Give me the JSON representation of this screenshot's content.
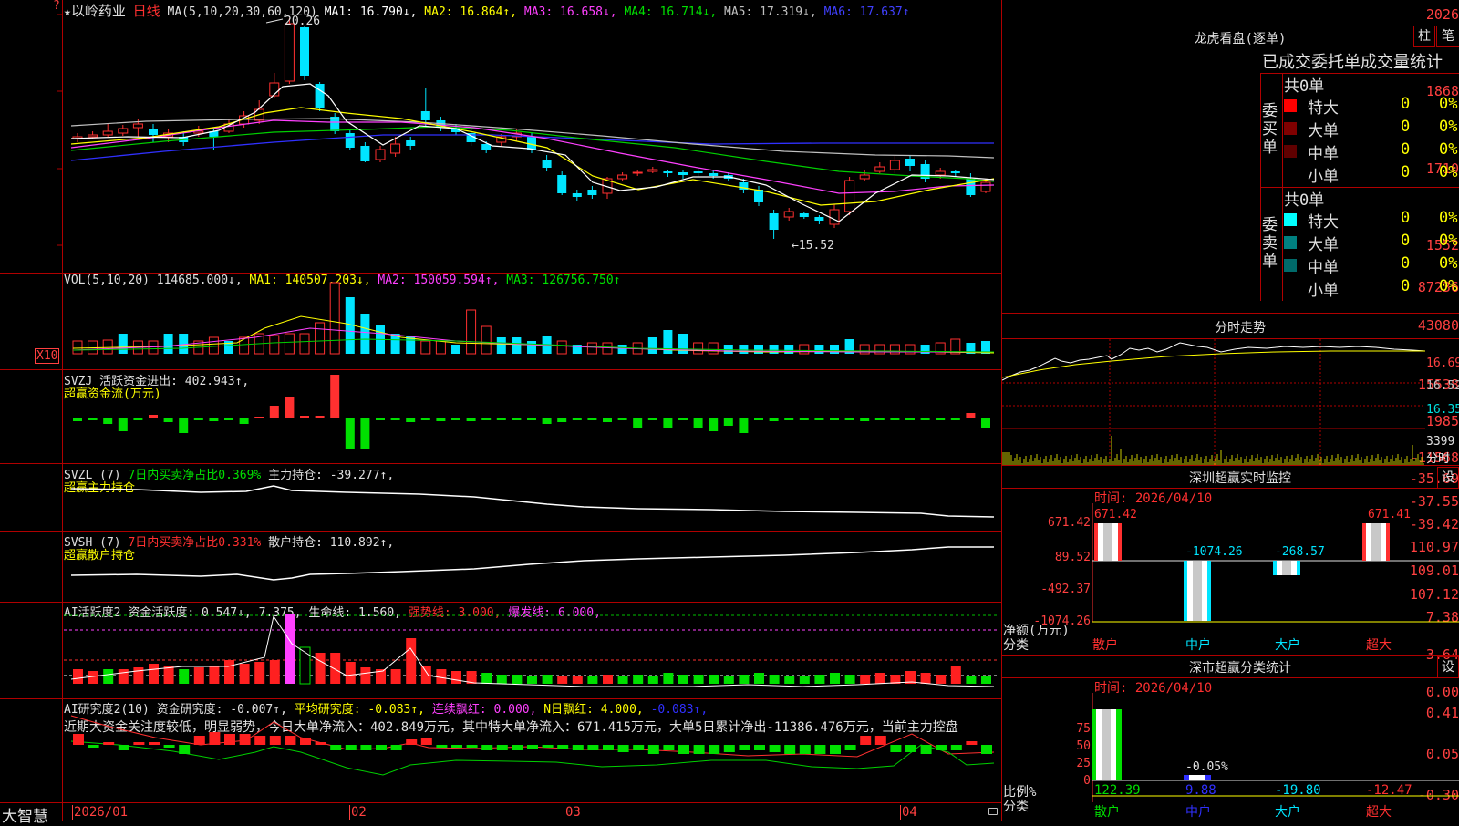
{
  "main_chart": {
    "star": "★",
    "stock_name": "以岭药业",
    "period": "日线",
    "ma_label": "MA(5,10,20,30,60,120)",
    "ma1": "MA1: 16.790↓,",
    "ma2": "MA2: 16.864↑,",
    "ma3": "MA3: 16.658↓,",
    "ma4": "MA4: 16.714↓,",
    "ma5": "MA5: 17.319↓,",
    "ma6": "MA6: 17.637↑",
    "y_ticks": [
      "2026",
      "1868",
      "1710",
      "1552"
    ],
    "high_label": "20.26",
    "low_label": "←15.52",
    "corner_q": "?"
  },
  "volume": {
    "label": "VOL(5,10,20)",
    "value": "114685.000↓,",
    "ma1": "MA1: 140507.203↓,",
    "ma2": "MA2: 150059.594↑,",
    "ma3": "MA3: 126756.750↑",
    "y_ticks": [
      "87236",
      "43080"
    ],
    "unit": "X10"
  },
  "svzj": {
    "label": "SVZJ",
    "text": "活跃资金进出: 402.943↑,",
    "sub": "超赢资金流(万元)",
    "y_ticks": [
      "15538",
      "1985",
      "-11568"
    ]
  },
  "svzl": {
    "label": "SVZL (7)",
    "text1": "7日内买卖净占比0.369%",
    "text2": "主力持仓: -39.277↑,",
    "sub": "超赢主力持仓",
    "y_ticks": [
      "-35.69",
      "-37.55",
      "-39.42"
    ]
  },
  "svsh": {
    "label": "SVSH (7)",
    "text1": "7日内买卖净占比0.331%",
    "text2": "散户持仓: 110.892↑,",
    "sub": "超赢散户持仓",
    "y_ticks": [
      "110.97",
      "109.01",
      "107.12"
    ]
  },
  "ai_active": {
    "label": "AI活跃度2",
    "t1": "资金活跃度: 0.547↓,",
    "t2": "7.375,",
    "t3": "生命线: 1.560,",
    "t4": "强势线: 3.000,",
    "t5": "爆发线: 6.000,",
    "y_ticks": [
      "7.38",
      "3.64",
      "0.00"
    ]
  },
  "ai_research": {
    "label": "AI研究度2(10)",
    "t1": "资金研究度: -0.007↑,",
    "t2": "平均研究度: -0.083↑,",
    "t3": "连续飘红: 0.000,",
    "t4": "N日飘红: 4.000,",
    "t5": "-0.083↑,",
    "commentary": "近期大资金关注度较低，明显弱势，今日大单净流入：402.849万元，其中特大单净流入：671.415万元，大单5日累计净出-11386.476万元，当前主力控盘",
    "y_ticks": [
      "0.41",
      "0.05",
      "-0.30"
    ]
  },
  "x_axis": {
    "labels": [
      "2026/01",
      "02",
      "03",
      "04"
    ],
    "brand": "大智慧"
  },
  "right_panel": {
    "lhb_title": "龙虎看盘(逐单)",
    "btn_zhu": "柱",
    "btn_bi": "笔",
    "stats_header": "已成交委托单成交量统计",
    "buy_total": "共0单",
    "sell_total": "共0单",
    "buy_side_label": "委买单",
    "sell_side_label": "委卖单",
    "buy_rows": [
      {
        "name": "特大",
        "v1": "0",
        "v2": "0%",
        "color": "#ff0000"
      },
      {
        "name": "大单",
        "v1": "0",
        "v2": "0%",
        "color": "#800000"
      },
      {
        "name": "中单",
        "v1": "0",
        "v2": "0%",
        "color": "#600000"
      },
      {
        "name": "小单",
        "v1": "0",
        "v2": "0%",
        "color": "#000000"
      }
    ],
    "sell_rows": [
      {
        "name": "特大",
        "v1": "0",
        "v2": "0%",
        "color": "#00ffff"
      },
      {
        "name": "大单",
        "v1": "0",
        "v2": "0%",
        "color": "#008080"
      },
      {
        "name": "中单",
        "v1": "0",
        "v2": "0%",
        "color": "#006a6a"
      },
      {
        "name": "小单",
        "v1": "0",
        "v2": "0%",
        "color": "#000000"
      }
    ],
    "intraday_title": "分时走势",
    "intraday_y": [
      "16.69",
      "16.52",
      "16.35"
    ],
    "intraday_vol": "3399",
    "intraday_vol_unit": "分时",
    "monitor_title": "深圳超赢实时监控",
    "monitor_btn": "设",
    "monitor_time": "时间: 2026/04/10",
    "monitor_y": [
      "671.42",
      "89.52",
      "-492.37",
      "-1074.26"
    ],
    "monitor_yunit": "净额(万元)",
    "monitor_cat": "分类",
    "monitor_bar_labels": [
      "671.42",
      "-1074.26",
      "-268.57",
      "671.41"
    ],
    "monitor_x": [
      "散户",
      "中户",
      "大户",
      "超大"
    ],
    "class_title": "深市超赢分类统计",
    "class_btn": "设",
    "class_time": "时间: 2026/04/10",
    "class_y": [
      "75",
      "50",
      "25",
      "0"
    ],
    "class_yunit": "比例%",
    "class_cat": "分类",
    "class_small_label": "-0.05%",
    "class_vals": [
      "122.39",
      "9.88",
      "-19.80",
      "-12.47"
    ],
    "class_x": [
      "散户",
      "中户",
      "大户",
      "超大"
    ]
  }
}
